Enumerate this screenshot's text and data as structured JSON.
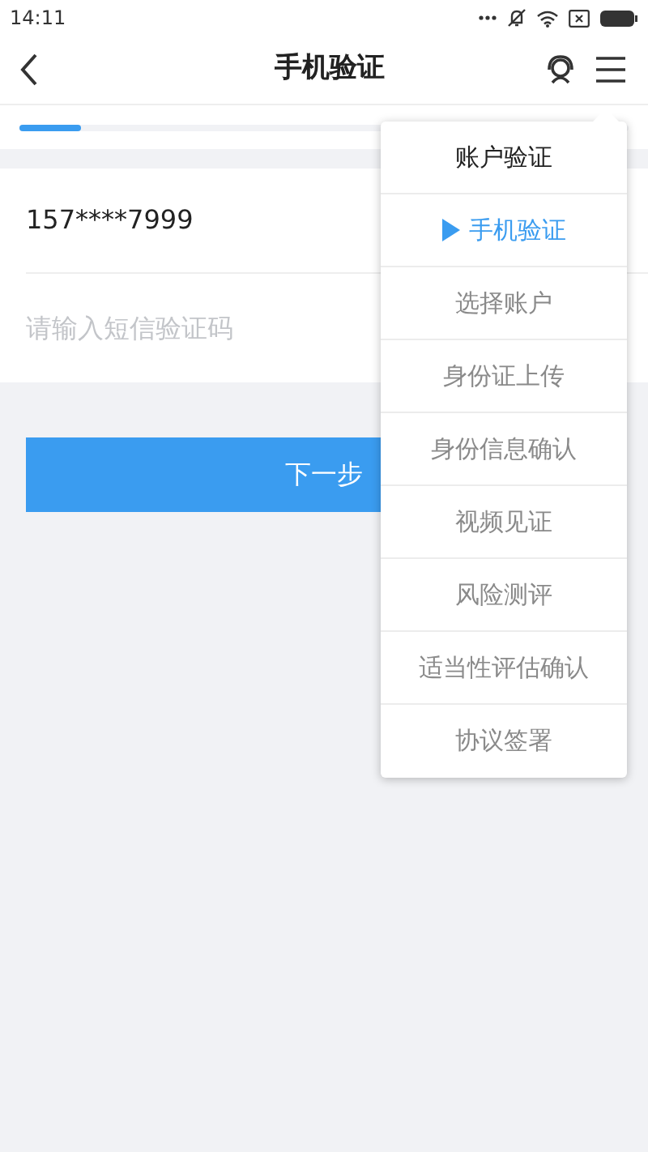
{
  "status_bar": {
    "time": "14:11"
  },
  "header": {
    "title": "手机验证"
  },
  "progress": {
    "level": 0.1
  },
  "form": {
    "phone": "157****7999",
    "code_field": {
      "placeholder": "请输入短信验证码"
    }
  },
  "next_button": {
    "label": "下一步"
  },
  "steps_menu": [
    {
      "label": "账户验证",
      "done": true,
      "selected": false
    },
    {
      "label": "手机验证",
      "done": false,
      "selected": true
    },
    {
      "label": "选择账户",
      "done": false,
      "selected": false
    },
    {
      "label": "身份证上传",
      "done": false,
      "selected": false
    },
    {
      "label": "身份信息确认",
      "done": false,
      "selected": false
    },
    {
      "label": "视频见证",
      "done": false,
      "selected": false
    },
    {
      "label": "风险测评",
      "done": false,
      "selected": false
    },
    {
      "label": "适当性评估确认",
      "done": false,
      "selected": false
    },
    {
      "label": "协议签署",
      "done": false,
      "selected": false
    }
  ]
}
